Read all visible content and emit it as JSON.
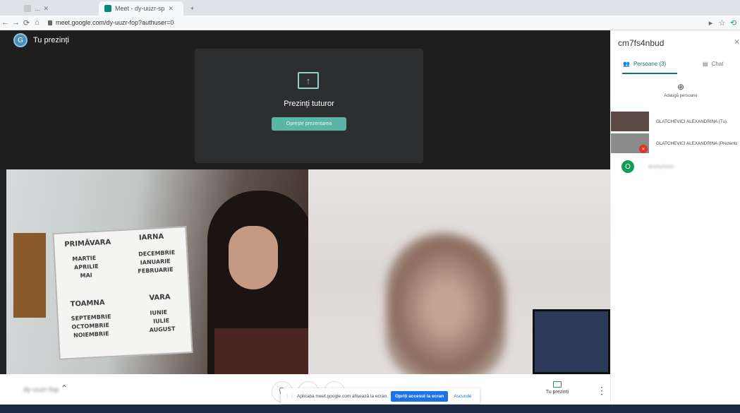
{
  "browser": {
    "tabs": [
      {
        "label": "...",
        "active": false
      },
      {
        "label": "Meet - dy-uuzr-sp",
        "active": true
      },
      {
        "label": "",
        "active": false
      }
    ],
    "url": "meet.google.com/dy-uuzr-fop?authuser=0"
  },
  "presenter": {
    "avatar_letter": "G",
    "badge_label": "Tu prezinți"
  },
  "present_card": {
    "title": "Prezinți tuturor",
    "stop_button": "Oprește prezentarea"
  },
  "board": {
    "words": [
      "PRIMĂVARA",
      "IARNA",
      "MARTIE",
      "APRILIE",
      "MAI",
      "DECEMBRIE",
      "IANUARIE",
      "FEBRUARIE",
      "TOAMNA",
      "VARA",
      "SEPTEMBRIE",
      "OCTOMBRIE",
      "NOIEMBRIE",
      "IUNIE",
      "IULIE",
      "AUGUST"
    ]
  },
  "bottom": {
    "meeting_name": "dy-uuzr-fop",
    "share_notice": "Aplicația meet.google.com afișează la ecran.",
    "stop_share": "Opriți accesul la ecran",
    "hide": "Ascunde",
    "you_present": "Tu prezinți"
  },
  "panel": {
    "meeting_code": "cm7fs4nbud",
    "tab_people": "Persoane (3)",
    "tab_chat": "Chat",
    "add_person": "Adaugă persoane",
    "participants": [
      {
        "name": "GLATCHEVICI ALEXANDRINA (Tu)"
      },
      {
        "name": "GLATCHEVICI ALEXANDRINA (Prezentare)"
      },
      {
        "name": "anonymous",
        "avatar_letter": "O"
      }
    ]
  }
}
